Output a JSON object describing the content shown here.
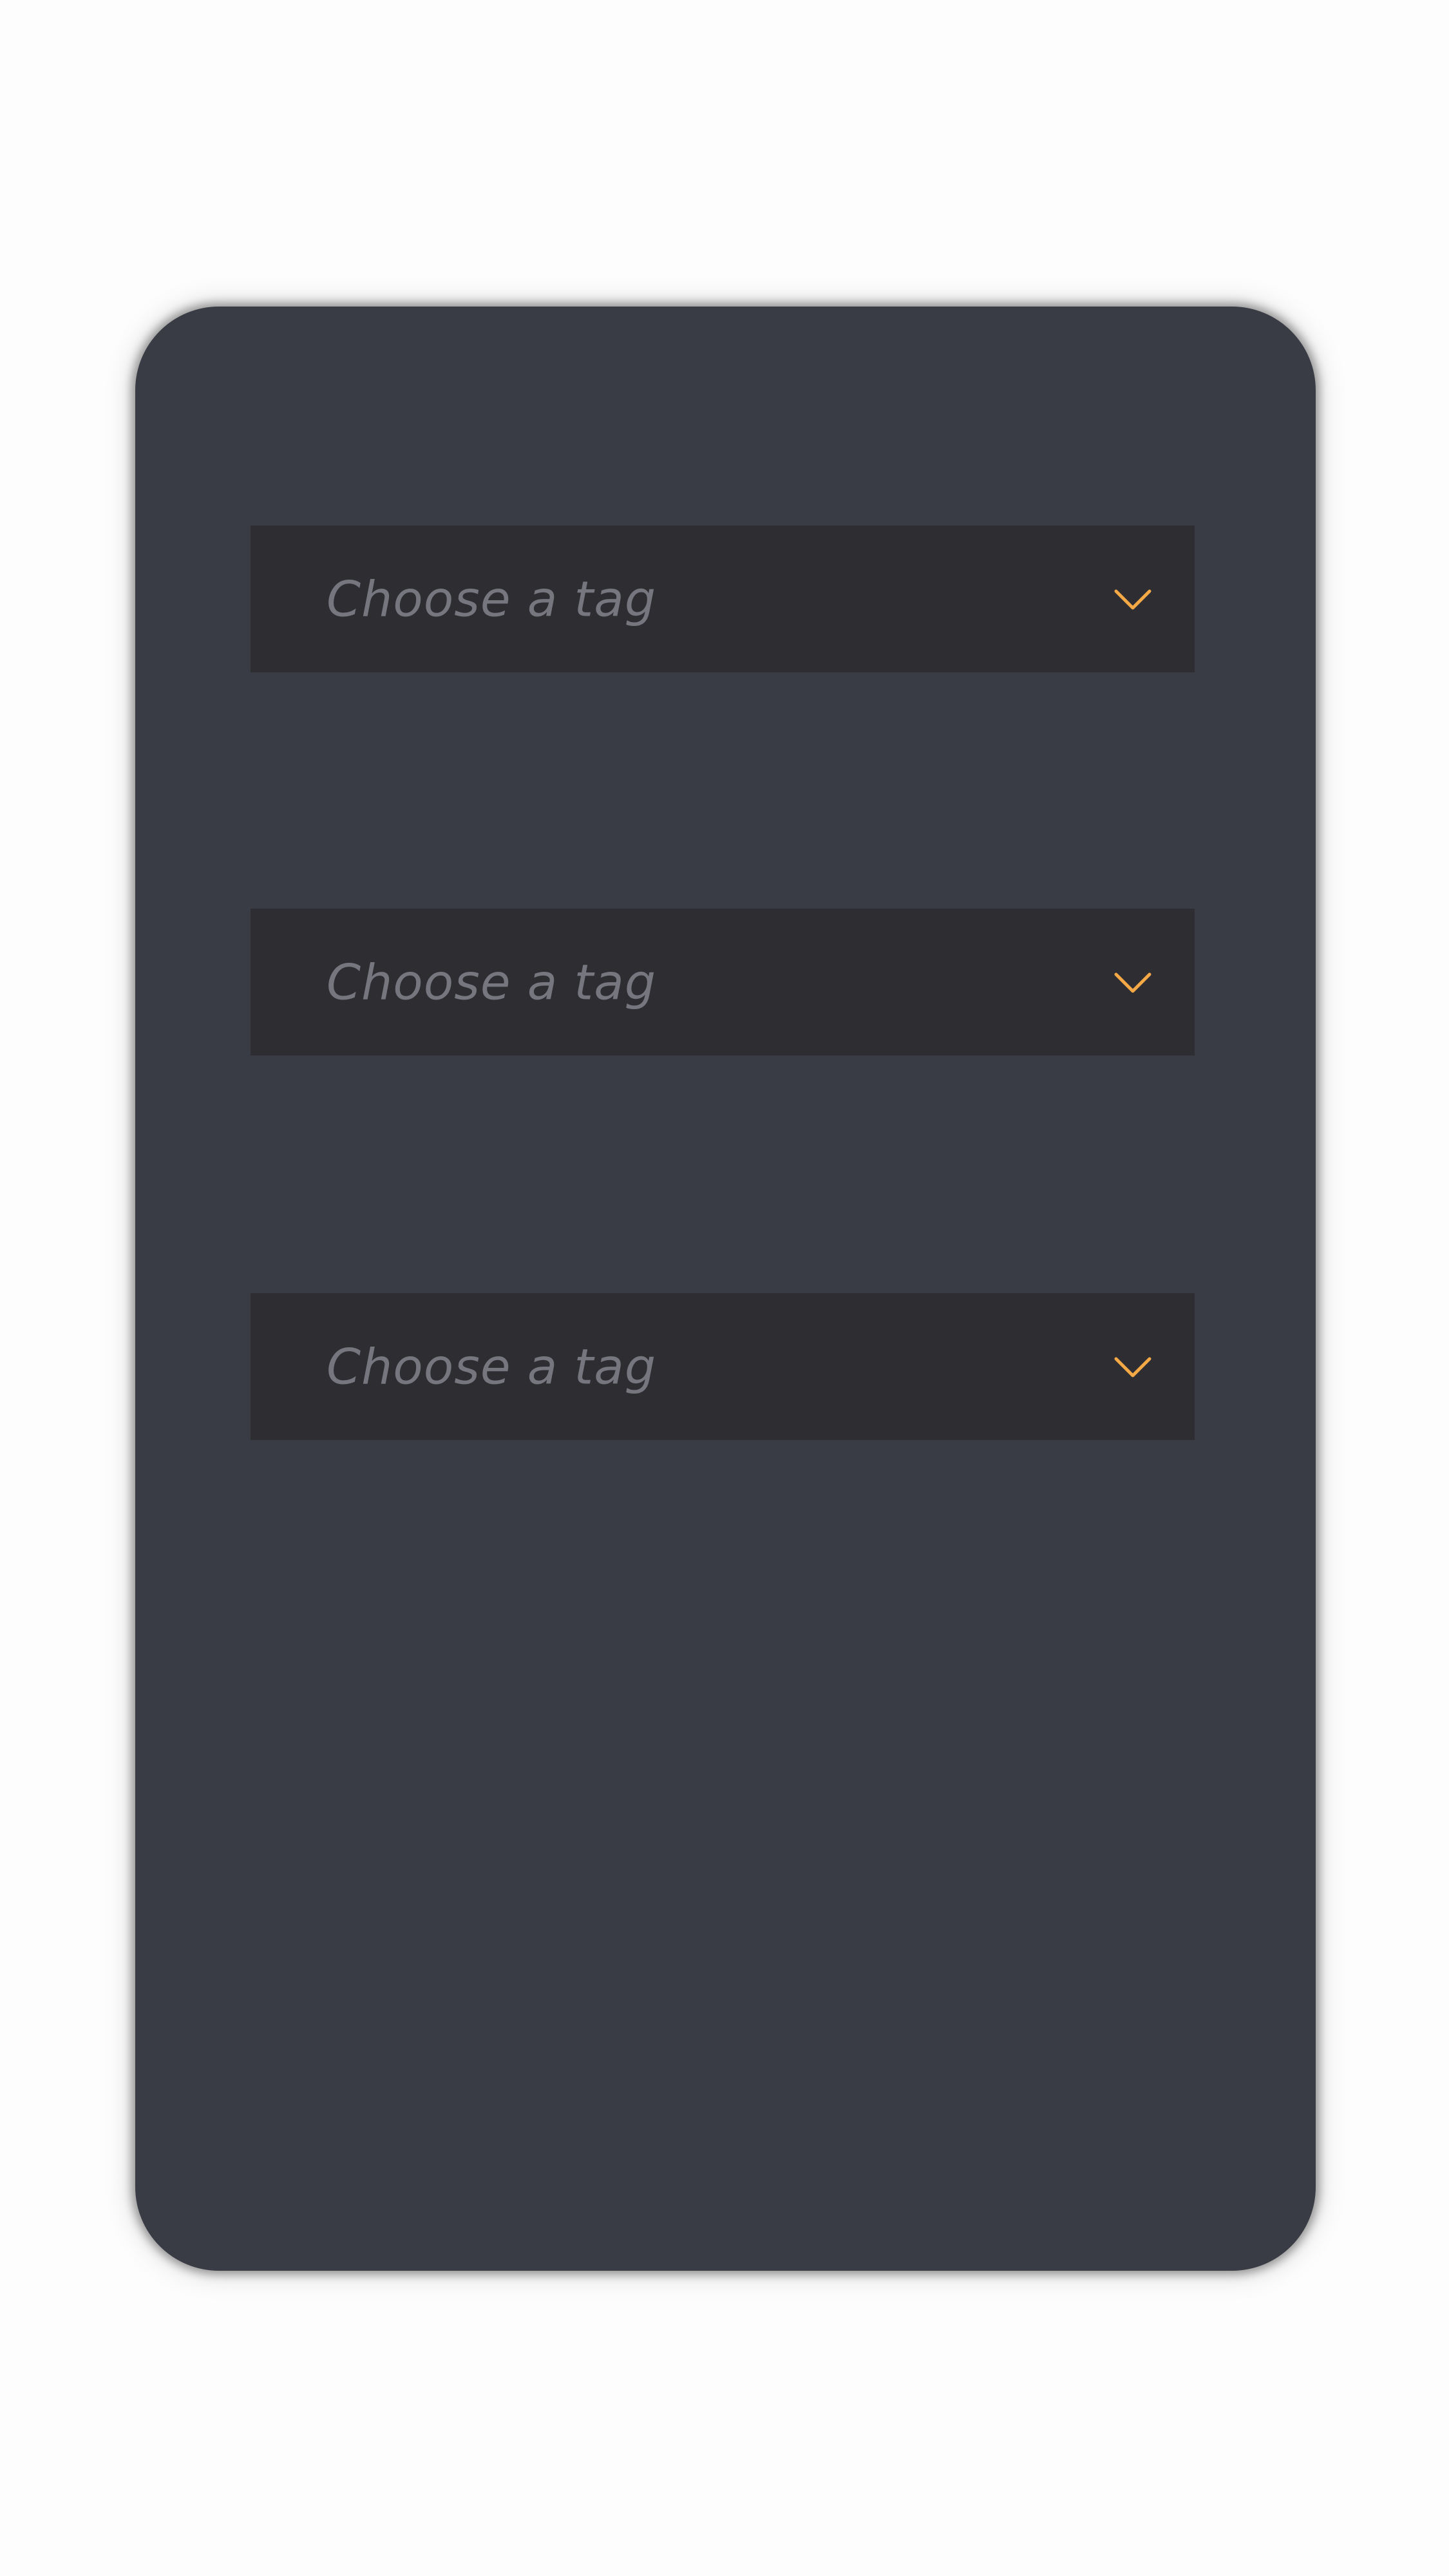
{
  "theme": {
    "accent": "#f5a846",
    "card_background": "#3a3c45",
    "select_background": "#2d2d32",
    "placeholder_color": "#75767e"
  },
  "selects": [
    {
      "placeholder": "Choose a tag",
      "icon": "chevron-down-icon"
    },
    {
      "placeholder": "Choose a tag",
      "icon": "chevron-down-icon"
    },
    {
      "placeholder": "Choose a tag",
      "icon": "chevron-down-icon"
    }
  ]
}
